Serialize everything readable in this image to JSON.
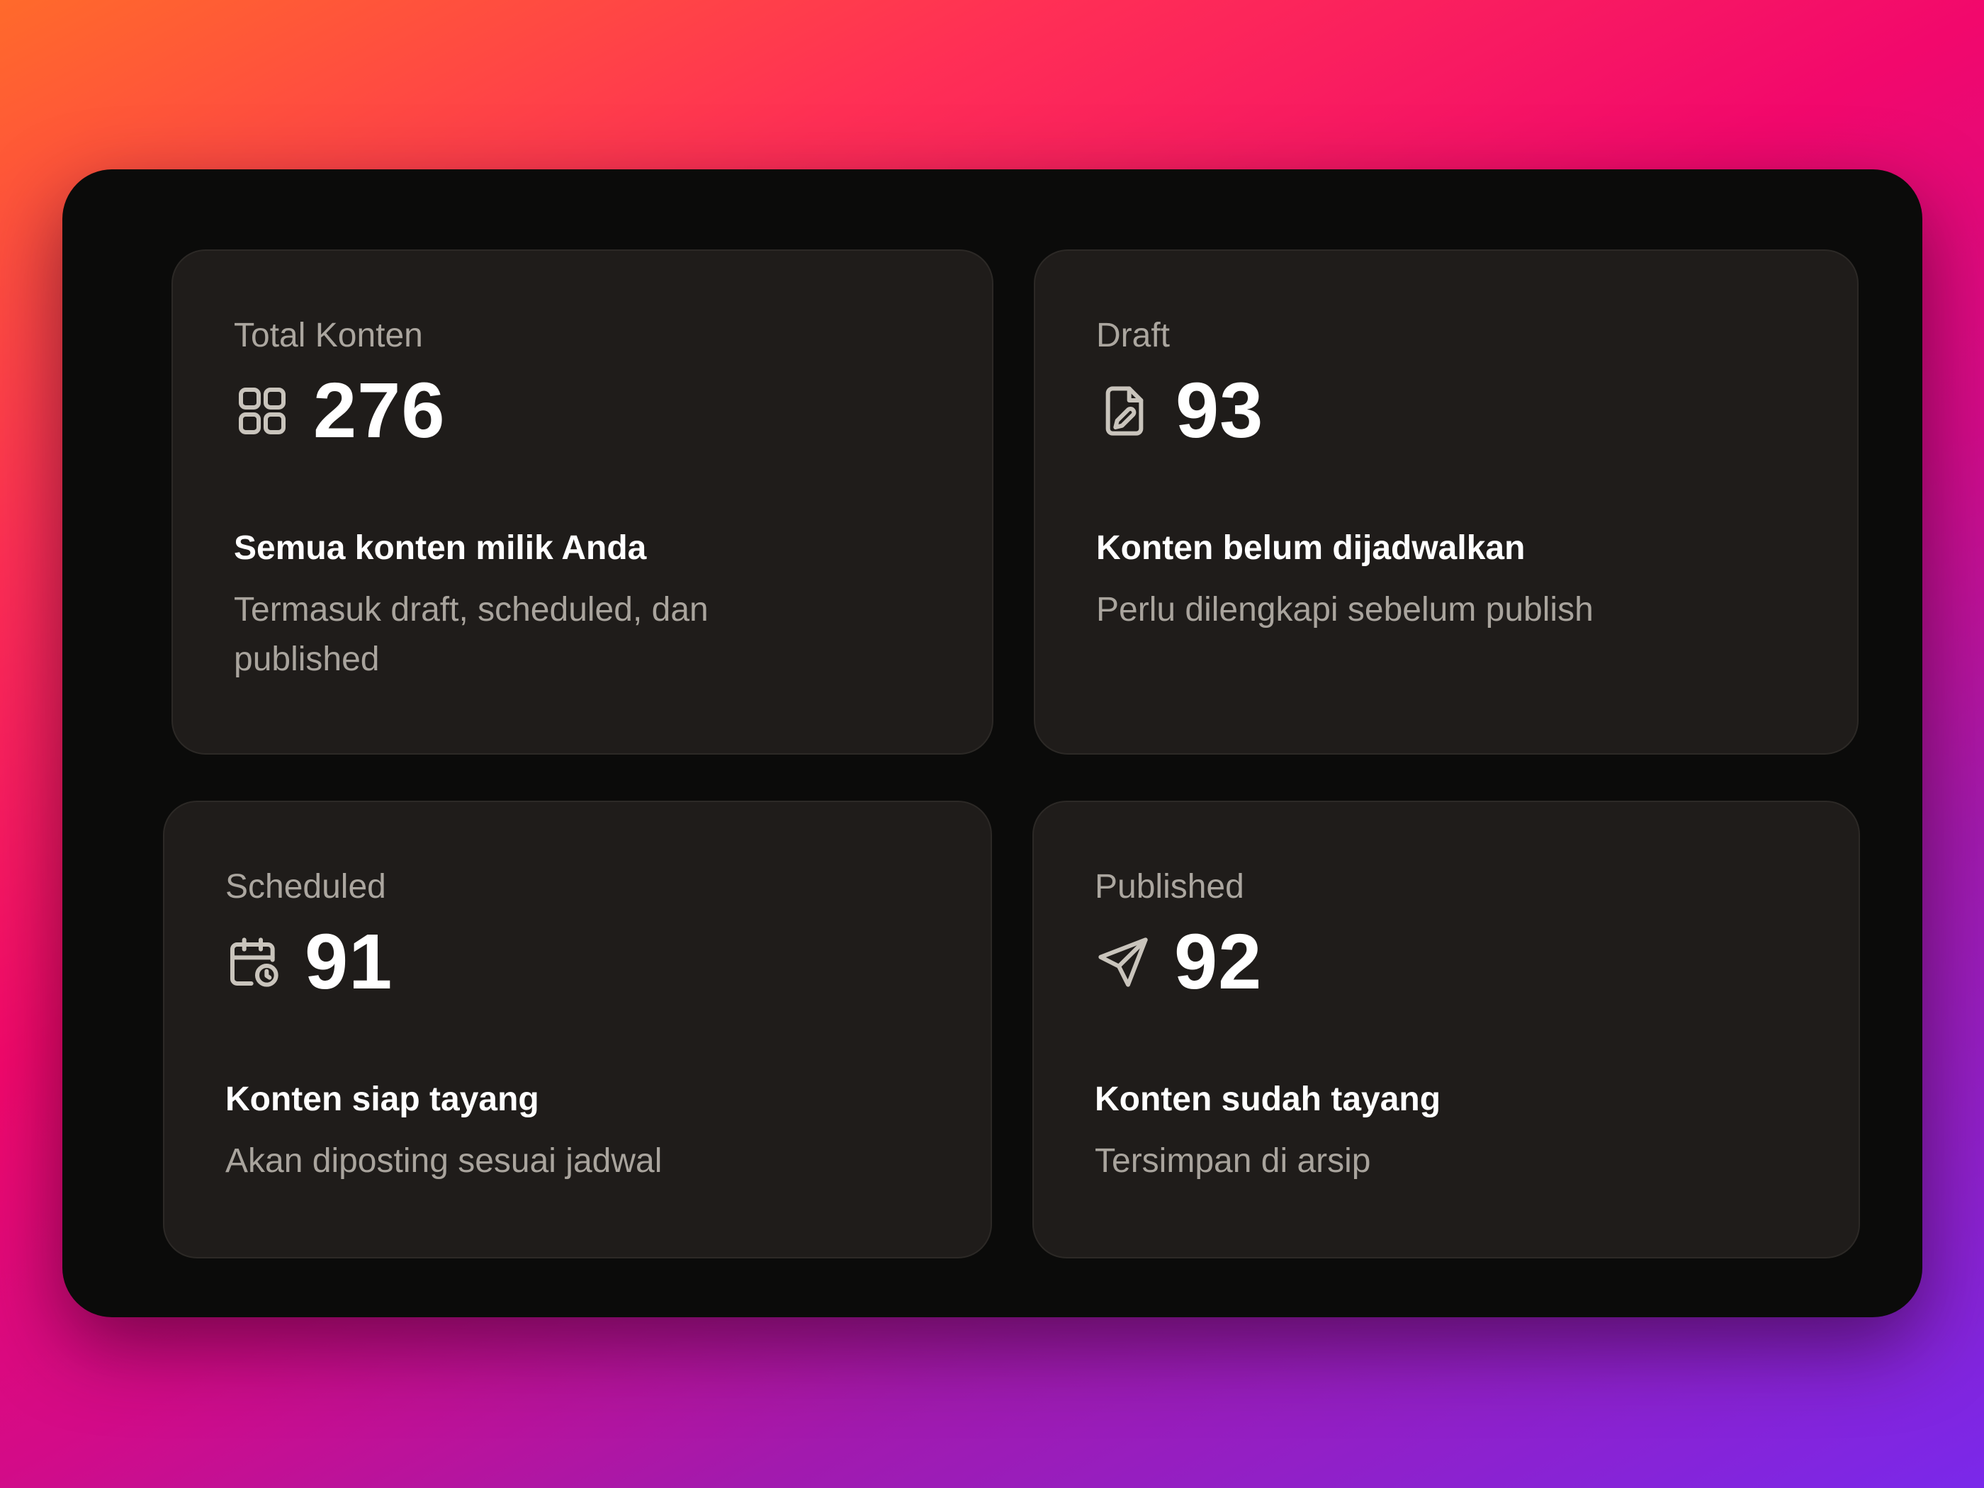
{
  "cards": [
    {
      "label": "Total Konten",
      "value": "276",
      "title": "Semua konten milik Anda",
      "description": "Termasuk draft, scheduled, dan published",
      "icon": "grid-icon"
    },
    {
      "label": "Draft",
      "value": "93",
      "title": "Konten belum dijadwalkan",
      "description": "Perlu dilengkapi sebelum publish",
      "icon": "file-edit-icon"
    },
    {
      "label": "Scheduled",
      "value": "91",
      "title": "Konten siap tayang",
      "description": "Akan diposting sesuai jadwal",
      "icon": "calendar-clock-icon"
    },
    {
      "label": "Published",
      "value": "92",
      "title": "Konten sudah tayang",
      "description": "Tersimpan di arsip",
      "icon": "send-icon"
    }
  ],
  "colors": {
    "card_background": "#1f1c1a",
    "panel_background": "#0b0b0a",
    "label_text": "#aba69f",
    "value_text": "#ffffff",
    "icon_stroke": "#c9c4bc"
  }
}
